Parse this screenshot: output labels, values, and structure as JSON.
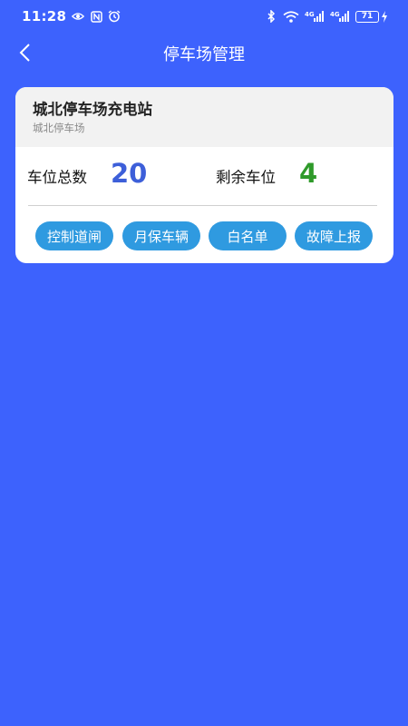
{
  "status_bar": {
    "time": "11:28",
    "battery_level": "71",
    "icons": [
      "eye-icon",
      "nfc-icon",
      "alarm-icon",
      "bluetooth-icon",
      "wifi-icon",
      "signal-4g-icon",
      "signal-4g-icon",
      "battery-icon",
      "charging-icon"
    ]
  },
  "header": {
    "title": "停车场管理",
    "back_icon": "chevron-left-icon"
  },
  "station": {
    "name": "城北停车场充电站",
    "subtitle": "城北停车场",
    "total_label": "车位总数",
    "total_value": "20",
    "remaining_label": "剩余车位",
    "remaining_value": "4",
    "actions": [
      "控制道闸",
      "月保车辆",
      "白名单",
      "故障上报"
    ]
  },
  "colors": {
    "background": "#3d62fd",
    "total_value": "#3d5fd9",
    "remaining_value": "#2f9a2a",
    "action_button": "#2f9ae0"
  }
}
